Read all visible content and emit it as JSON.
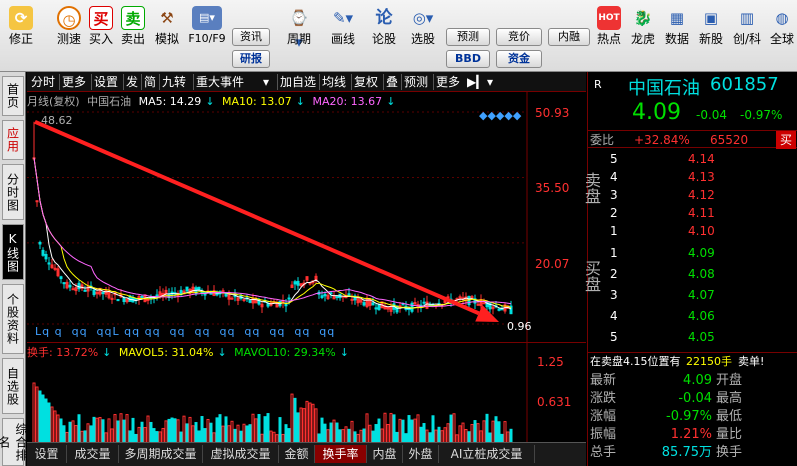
{
  "toolbar": {
    "items": [
      {
        "label": "修正",
        "icon": "refresh-icon"
      },
      {
        "label": "测速",
        "icon": "clock-icon"
      },
      {
        "label": "买入",
        "icon": "buy-icon",
        "glyph": "买"
      },
      {
        "label": "卖出",
        "icon": "sell-icon",
        "glyph": "卖"
      },
      {
        "label": "模拟",
        "icon": "hammer-icon"
      },
      {
        "label": "F10/F9",
        "icon": "f10-icon"
      },
      {
        "label": "周期",
        "icon": "period-icon"
      },
      {
        "label": "画线",
        "icon": "draw-icon"
      },
      {
        "label": "论股",
        "icon": "discuss-icon",
        "glyph": "论"
      },
      {
        "label": "选股",
        "icon": "select-stock-icon"
      },
      {
        "label": "热点",
        "icon": "hotspot-icon"
      },
      {
        "label": "龙虎",
        "icon": "dragon-tiger-icon"
      },
      {
        "label": "数据",
        "icon": "data-icon"
      },
      {
        "label": "新股",
        "icon": "new-stock-icon"
      },
      {
        "label": "创/科",
        "icon": "gem-star-icon"
      },
      {
        "label": "全球",
        "icon": "global-icon"
      }
    ],
    "buttons": {
      "zixun": "资讯",
      "yanbao": "研报",
      "yuce": "预测",
      "jingjia": "竞价",
      "neirong": "内融",
      "bbd": "BBD",
      "zijin": "资金"
    }
  },
  "left_tabs": [
    "首页",
    "应用",
    "分时图",
    "K线图",
    "个股资料",
    "自选股",
    "综合排名"
  ],
  "chart_menu": [
    "分时",
    "更多",
    "设置",
    "发",
    "简",
    "九转",
    "重大事件",
    "加自选",
    "均线",
    "复权",
    "叠",
    "预测",
    "更多"
  ],
  "main_legend": {
    "period": "月线(复权)",
    "name": "中国石油",
    "ma5": "MA5: 14.29",
    "ma10": "MA10: 13.07",
    "ma20": "MA20: 13.67"
  },
  "vol_legend": {
    "turnover": "换手: 13.72%",
    "mavol5": "MAVOL5: 31.04%",
    "mavol10": "MAVOL10: 29.34%"
  },
  "colors": {
    "up": "#ff3030",
    "down": "#00e0e0",
    "ma5": "#ffffff",
    "ma10": "#ffff00",
    "ma20": "#ff66ff",
    "arrow": "#ff2020"
  },
  "chart_data": {
    "type": "candlestick",
    "title": "",
    "ylabels": [
      "50.93",
      "35.50",
      "20.07",
      "0.96"
    ],
    "high_label": "48.62",
    "low_label": "0.96",
    "ylim": [
      0.96,
      50.93
    ],
    "vol_ylabels": [
      "1.25",
      "0.631"
    ],
    "x_markers": "Lq q  qq  qqL qq qq  qq  qq  qq  qq  qq  qq  qq",
    "annotation": "arrow from high 48.62 to low 0.96 (red downward arrow)"
  },
  "bottom_tabs": [
    "设置",
    "成交量",
    "多周期成交量",
    "虚拟成交量",
    "金额",
    "换手率",
    "内盘",
    "外盘",
    "AI立桩成交量"
  ],
  "quote": {
    "market": "R",
    "name": "中国石油",
    "code": "601857",
    "price": "4.09",
    "change": "-0.04",
    "change_pct": "-0.97%",
    "weibi_label": "委比",
    "weibi": "+32.84%",
    "weicha": "65520",
    "weicha_tag": "买",
    "sell_label": "卖盘",
    "buy_label": "买盘",
    "sells": [
      {
        "level": "5",
        "price": "4.14"
      },
      {
        "level": "4",
        "price": "4.13"
      },
      {
        "level": "3",
        "price": "4.12"
      },
      {
        "level": "2",
        "price": "4.11"
      },
      {
        "level": "1",
        "price": "4.10"
      }
    ],
    "buys": [
      {
        "level": "1",
        "price": "4.09"
      },
      {
        "level": "2",
        "price": "4.08"
      },
      {
        "level": "3",
        "price": "4.07"
      },
      {
        "level": "4",
        "price": "4.06"
      },
      {
        "level": "5",
        "price": "4.05"
      }
    ],
    "notice": "在卖盘4.15位置有",
    "notice_vol": "22150手",
    "notice_tag": "卖单!",
    "stats": [
      {
        "k": "最新",
        "v": "4.09",
        "k2": "开盘"
      },
      {
        "k": "涨跌",
        "v": "-0.04",
        "k2": "最高"
      },
      {
        "k": "涨幅",
        "v": "-0.97%",
        "k2": "最低"
      },
      {
        "k": "振幅",
        "v": "1.21%",
        "k2": "量比"
      },
      {
        "k": "总手",
        "v": "85.75万",
        "k2": "换手"
      }
    ]
  }
}
